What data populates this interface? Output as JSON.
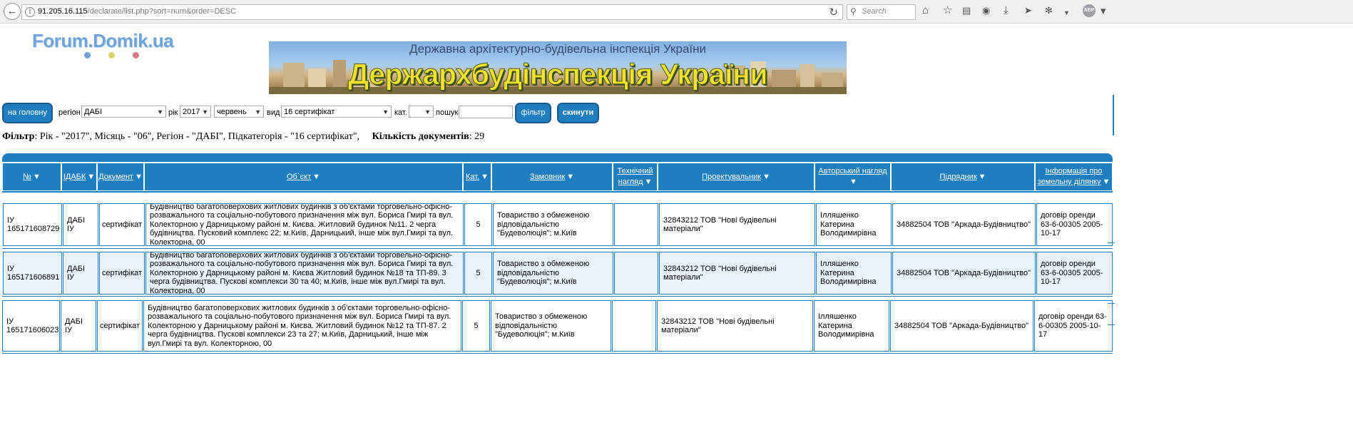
{
  "browser": {
    "url_host": "91.205.16.115",
    "url_path": "/declarate/list.php?sort=num&order=DESC",
    "search_placeholder": "Search",
    "icons": [
      "back-icon",
      "info-icon",
      "reload-icon",
      "search-icon",
      "home-icon",
      "bookmark-star-icon",
      "reading-list-icon",
      "pocket-icon",
      "download-icon",
      "send-icon",
      "extension-icon",
      "adblock-icon",
      "menu-icon"
    ]
  },
  "logo": {
    "text": "Forum.Domik.ua",
    "dot_colors": [
      "#6fa3d9",
      "#d7d36a",
      "#d07a8a"
    ]
  },
  "banner": {
    "subtitle": "Державна архітектурно-будівельна інспекція України",
    "title": "Держархбудінспекція України"
  },
  "filters": {
    "home_button": "на головну",
    "region_label": "регіон",
    "region_value": "ДАБІ",
    "year_label": "рік",
    "year_value": "2017",
    "month_value": "червень",
    "type_label": "вид",
    "type_value": "16 сертифікат",
    "cat_label": "кат.",
    "cat_value": "",
    "search_label": "пошук",
    "search_value": "",
    "filter_button": "фільтр",
    "reset_button": "скинути"
  },
  "summary": {
    "filter_label": "Фільтр",
    "filter_text": ": Рік - \"2017\", Місяць - \"06\", Регіон - \"ДАБІ\", Підкатегорія - \"16 сертифікат\",",
    "count_label": "Кількість документів",
    "count_value": ": 29"
  },
  "table": {
    "headers": [
      {
        "line1": "№",
        "line2": ""
      },
      {
        "line1": "ІДАБК",
        "line2": ""
      },
      {
        "line1": "Документ",
        "line2": ""
      },
      {
        "line1": "Об`єкт",
        "line2": ""
      },
      {
        "line1": "Кат.",
        "line2": ""
      },
      {
        "line1": "Замовник",
        "line2": ""
      },
      {
        "line1": "Технічний",
        "line2": "нагляд"
      },
      {
        "line1": "Проектувальник",
        "line2": ""
      },
      {
        "line1": "Авторський нагляд",
        "line2": ""
      },
      {
        "line1": "Підрядник",
        "line2": ""
      },
      {
        "line1": "Інформація про",
        "line2": "земельну ділянку"
      }
    ],
    "rows": [
      {
        "num": "ІУ 165171608729",
        "idabk": "ДАБІ ІУ",
        "doc": "сертифікат",
        "object": "Будівництво багатоповерхових житлових будинків з об'єктами торговельно-офісно-розважального та соціально-побутового призначення між вул. Бориса Гмирі та вул. Колекторною у Дарницькому районі м. Києва. Житловий будинок №11. 2 черга будівництва. Пусковий комплекс 22; м.Київ, Дарницький, інше між вул.Гмирі та вул. Колекторна, 00",
        "cat": "5",
        "customer": "Товариство з обмеженою відповідальністю \"Будеволюція\"; м.Київ",
        "tech": "",
        "designer": "32843212 ТОВ \"Нові будівельні матеріали\"",
        "author": "Ілляшенко Катерина Володимирівна",
        "contractor": "34882504 ТОВ \"Аркада-Будівництво\"",
        "land": "договір оренди 63-6-00305 2005-10-17"
      },
      {
        "num": "ІУ 165171606891",
        "idabk": "ДАБІ ІУ",
        "doc": "сертифікат",
        "object": "Будівництво багатоповерхових житлових будинків з об'єктами торговельно-офісно-розважального та соціально-побутового призначення між вул. Бориса Гмирі та вул. Колекторною у Дарницькому районі м. Києва Житловий будинок №18 та ТП-89. 3 черга будівництва. Пускові комплекси 30 та 40; м.Київ, інше між вул.Гмирі та вул. Колекторна, 00",
        "cat": "5",
        "customer": "Товариство з обмеженою відповідальністю \"Будеволюція\"; м.Київ",
        "tech": "",
        "designer": "32843212 ТОВ \"Нові будівельні матеріали\"",
        "author": "Ілляшенко Катерина Володимирівна",
        "contractor": "34882504 ТОВ \"Аркада-Будівництво\"",
        "land": "договір оренди 63-6-00305 2005-10-17"
      },
      {
        "num": "ІУ 165171606023",
        "idabk": "ДАБІ ІУ",
        "doc": "сертифікат",
        "object": "Будівництво багатоповерхових житлових будинків з об'єктами торговельно-офісно-розважального та соціально-побутового призначення між вул. Бориса Гмирі та вул. Колекторною у Дарницькому районі м. Києва. Житловий будинок №12 та ТП-87. 2 черга будівництва. Пускові комплекси 23 та 27; м.Київ, Дарницький, інше між вул.Гмирі та вул. Колекторною, 00",
        "cat": "5",
        "customer": "Товариство з обмеженою відповідальністю \"Будеволюція\"; м.Київ",
        "tech": "",
        "designer": "32843212 ТОВ \"Нові будівельні матеріали\"",
        "author": "Ілляшенко Катерина Володимирівна",
        "contractor": "34882504 ТОВ \"Аркада-Будівництво\"",
        "land": "договір оренди 63-6-00305 2005-10-17"
      }
    ]
  },
  "colors": {
    "accent": "#1f7ec0",
    "row_alt": "#eaf3fb"
  }
}
